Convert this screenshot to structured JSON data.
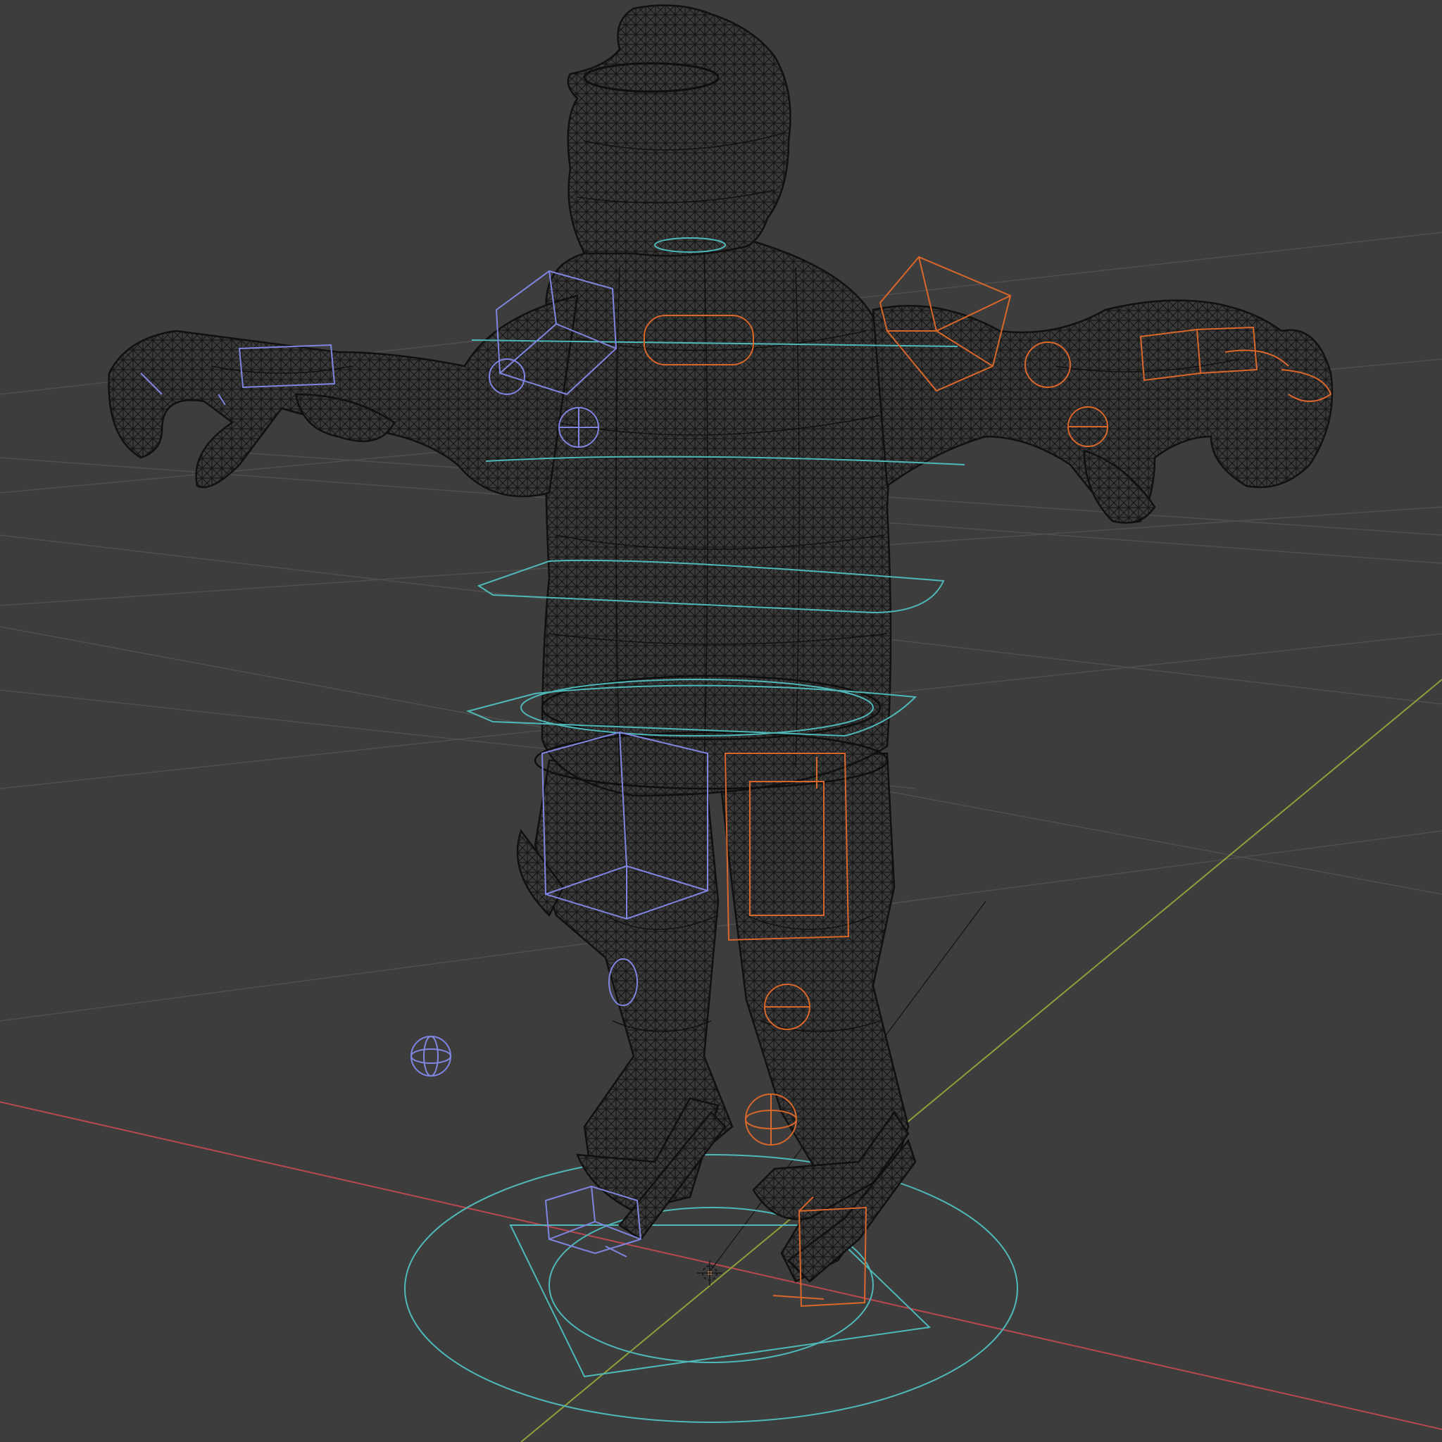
{
  "viewport": {
    "mode": "3d-viewport-wireframe",
    "background_color": "#3d3d3d",
    "grid_color": "#4e4e4e",
    "x_axis_color": "#b8484f",
    "y_axis_color": "#8ea03a",
    "mesh_wire_color": "#141414",
    "mesh_fill_color": "#383838"
  },
  "rig": {
    "root_color": "#4fb8b8",
    "left_controls_color": "#7f85e0",
    "right_controls_color": "#d9662a",
    "torso_rings": 5
  },
  "scene_objects": {
    "mesh": "character-mesh",
    "armature_controls": "rig-controls",
    "origin": "3d-cursor-icon"
  }
}
